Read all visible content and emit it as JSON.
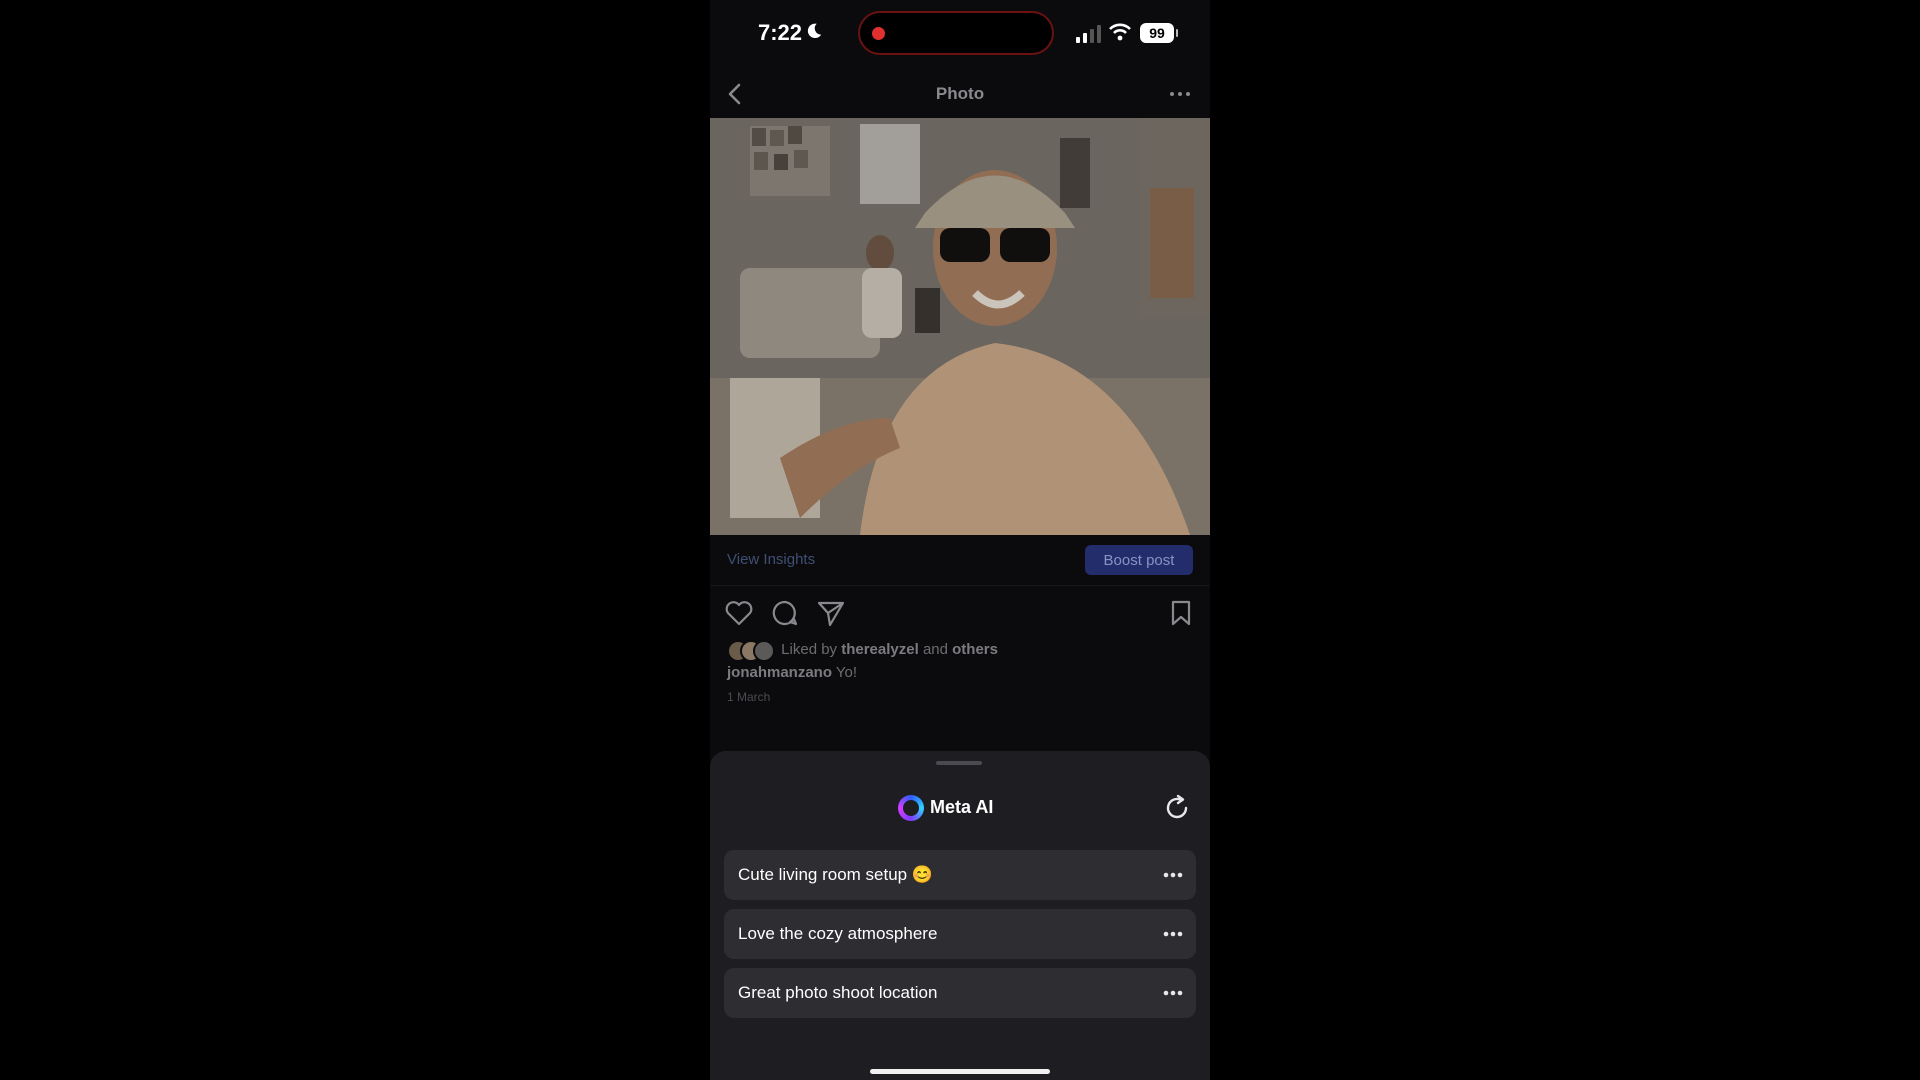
{
  "status_bar": {
    "time": "7:22",
    "battery": "99"
  },
  "nav": {
    "title": "Photo"
  },
  "post": {
    "view_insights": "View Insights",
    "boost_label": "Boost post",
    "liked_by_prefix": "Liked by",
    "liked_by_user": "therealyzel",
    "liked_by_and": "and",
    "liked_by_others": "others",
    "caption_user": "jonahmanzano",
    "caption_text": "Yo!",
    "date": "1 March"
  },
  "meta_ai": {
    "title": "Meta AI",
    "suggestions": [
      {
        "text": "Cute living room setup 😊"
      },
      {
        "text": "Love the cozy atmosphere"
      },
      {
        "text": "Great photo shoot location"
      }
    ]
  },
  "colors": {
    "accent": "#232d6b",
    "recording": "#e23030",
    "sheet": "#1e1e22"
  }
}
